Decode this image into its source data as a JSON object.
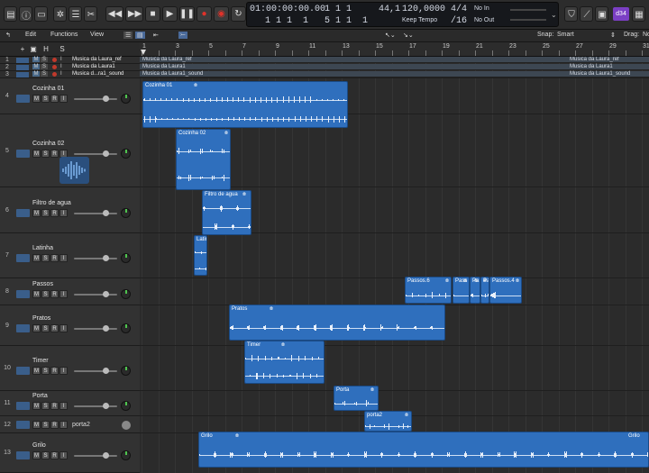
{
  "toolbar": {
    "position_time": "01:00:00:00.00",
    "position_bars": "1 1 1",
    "position_bars2": "1 1 1",
    "position_bars3": "1",
    "position_bars4": "5 1 1",
    "position_bars5": "1",
    "tempo": "44,1",
    "bpm": "120,0000",
    "sig": "4/4",
    "keep_tempo": "Keep Tempo",
    "division": "/16",
    "no_in": "No In",
    "no_out": "No Out",
    "cpu": "d34"
  },
  "menu": {
    "edit": "Edit",
    "functions": "Functions",
    "view": "View",
    "snap_label": "Snap:",
    "snap_value": "Smart",
    "drag_label": "Drag:",
    "drag_value": "No"
  },
  "header": {
    "h": "H",
    "s": "S"
  },
  "ruler": [
    "1",
    "3",
    "5",
    "7",
    "9",
    "11",
    "13",
    "15",
    "17",
    "19",
    "21",
    "23",
    "25",
    "27",
    "29",
    "31"
  ],
  "global_tracks": [
    {
      "num": "1",
      "name": "Musica da Laura_ref",
      "region": "Musica da Laura_ref",
      "region_end": "Musica da Laura_ref"
    },
    {
      "num": "2",
      "name": "Musica da Laura1",
      "region": "Musica da Laura1",
      "region_end": "Musica da Laura1"
    },
    {
      "num": "3",
      "name": "Musica d...ra1_sound",
      "region": "Musica da Laura1_sound",
      "region_end": "Musica da Laura1_sound"
    }
  ],
  "tracks": [
    {
      "num": "4",
      "name": "Cozinha 01"
    },
    {
      "num": "5",
      "name": "Cozinha 02"
    },
    {
      "num": "6",
      "name": "Filtro de agua"
    },
    {
      "num": "7",
      "name": "Latinha"
    },
    {
      "num": "8",
      "name": "Passos"
    },
    {
      "num": "9",
      "name": "Pratos"
    },
    {
      "num": "10",
      "name": "Timer"
    },
    {
      "num": "11",
      "name": "Porta"
    },
    {
      "num": "12",
      "name": "porta2",
      "routing": "porta2"
    },
    {
      "num": "13",
      "name": "Grilo"
    }
  ],
  "buttons": {
    "m": "M",
    "s": "S",
    "r": "R",
    "i": "I"
  },
  "regions": {
    "cozinha01": "Cozinha 01",
    "cozinha02": "Cozinha 02",
    "filtro": "Filtro de agua",
    "latinha": "Latin",
    "passos6": "Passos.6",
    "passos_a": "Pass",
    "passos_b": "Pa",
    "passos_c": "Pa",
    "passos4": "Passos.4",
    "pratos": "Pratos",
    "timer": "Timer",
    "porta": "Porta",
    "porta2": "porta2",
    "grilo": "Grilo",
    "grilo_end": "Grilo"
  }
}
